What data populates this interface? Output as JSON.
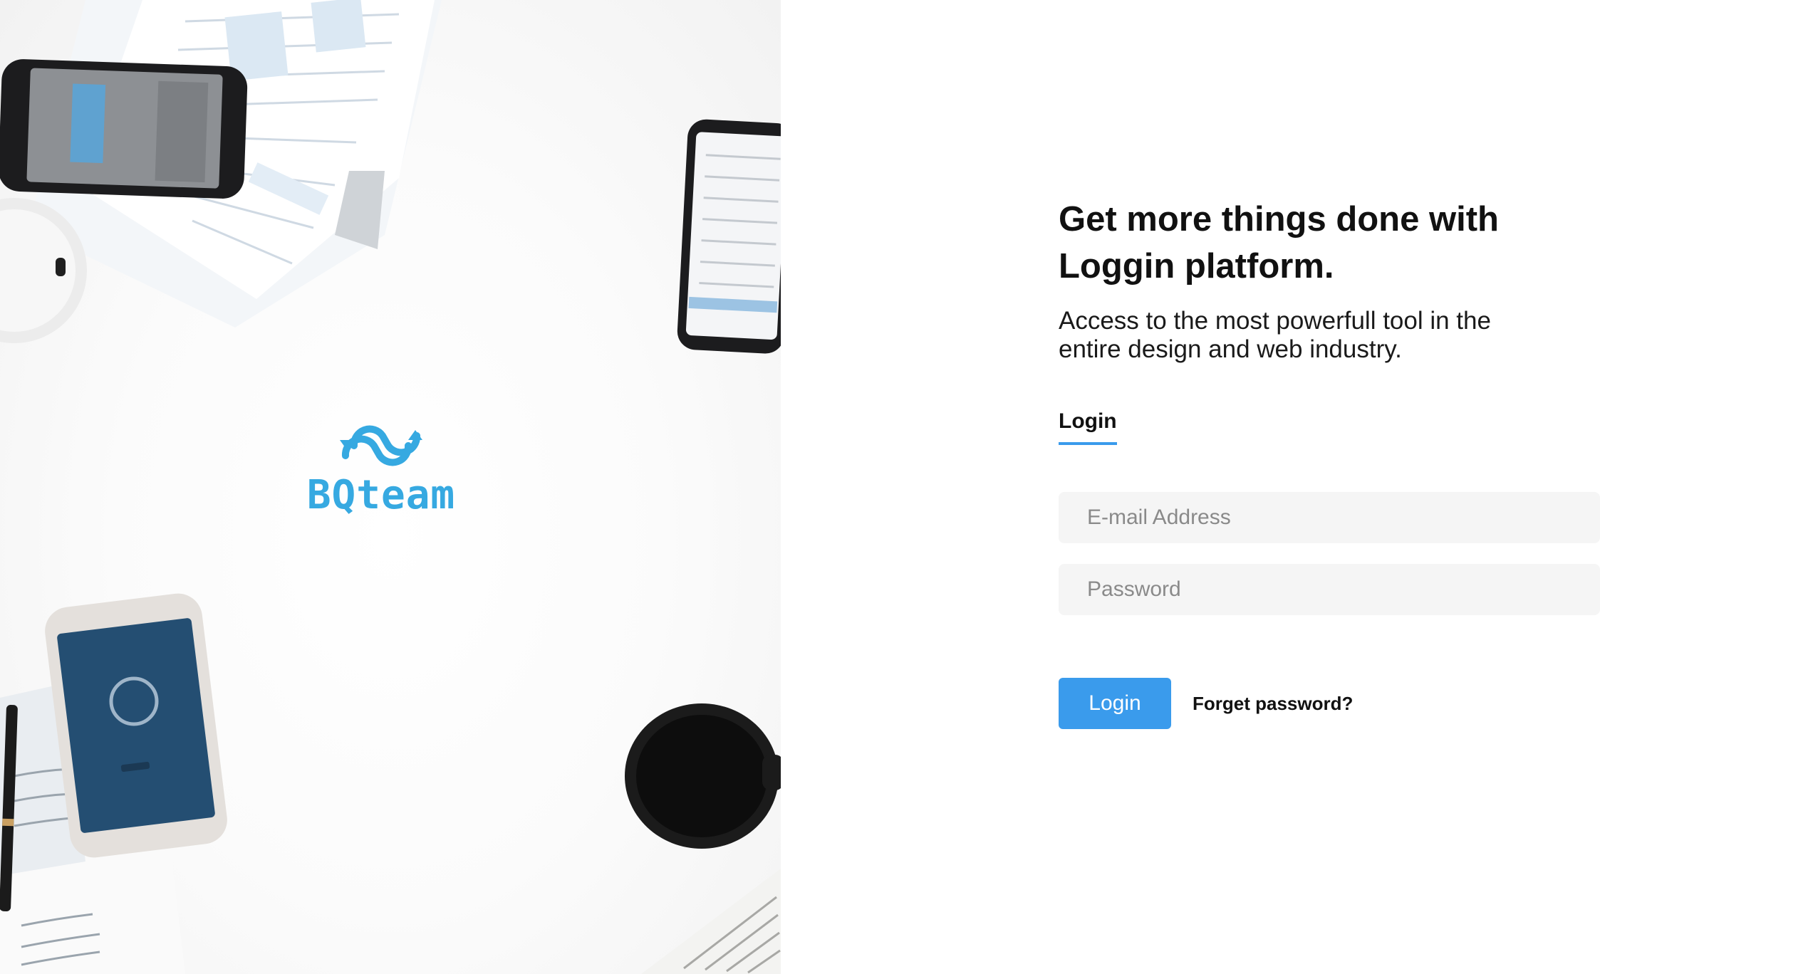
{
  "brand": {
    "name": "BQteam",
    "logo_icon": "sync-arrows-icon",
    "color": "#36a9e1"
  },
  "form": {
    "headline": "Get more things done with Loggin platform.",
    "subheadline": "Access to the most powerfull tool in the entire design and web industry.",
    "tab_label": "Login",
    "email": {
      "placeholder": "E-mail Address",
      "value": ""
    },
    "password": {
      "placeholder": "Password",
      "value": ""
    },
    "login_button_label": "Login",
    "forgot_password_label": "Forget password?"
  },
  "colors": {
    "accent": "#3a9bec",
    "field_background": "#f5f5f5",
    "text": "#111111"
  }
}
